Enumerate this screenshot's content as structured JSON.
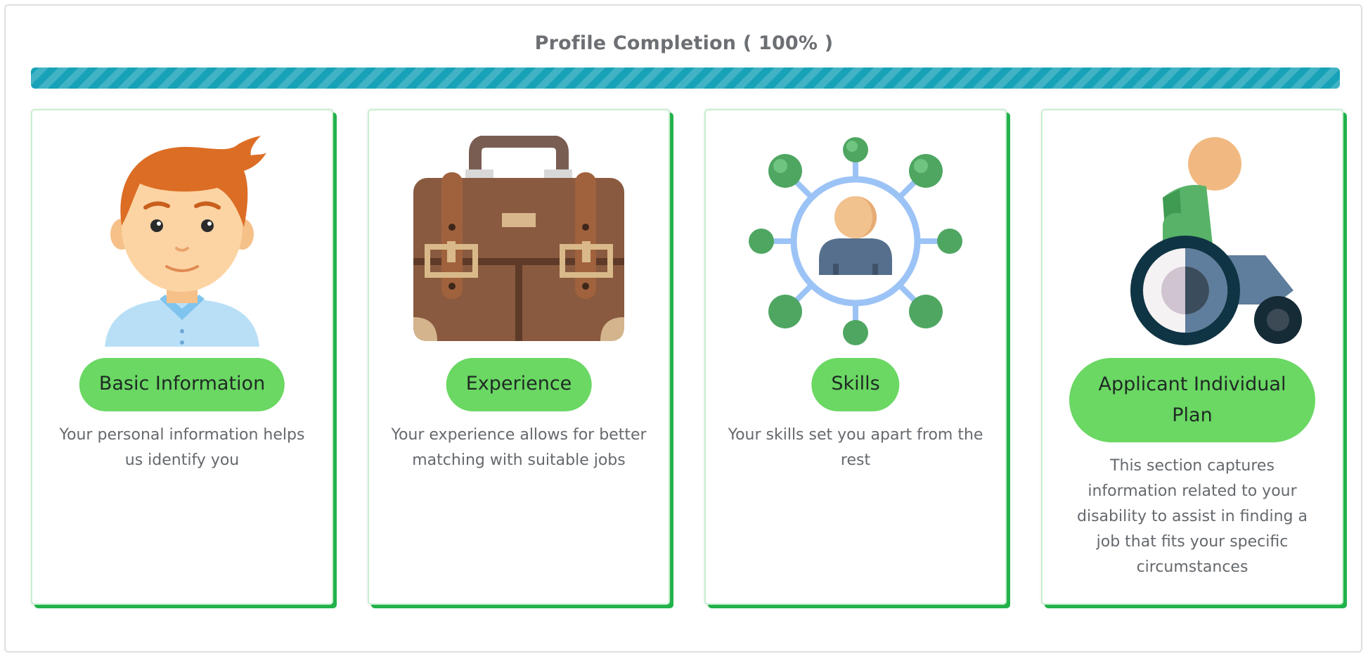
{
  "header": {
    "title": "Profile Completion ( 100% )",
    "progress_percent": 100,
    "progress_color": "#17a2b8"
  },
  "colors": {
    "pill": "#6ad863",
    "card_shadow": "#22b24c",
    "text_muted": "#65696d"
  },
  "cards": [
    {
      "icon": "person-avatar-icon",
      "button_label": "Basic Information",
      "description": "Your personal information helps us identify you"
    },
    {
      "icon": "briefcase-icon",
      "button_label": "Experience",
      "description": "Your experience allows for better matching with suitable jobs"
    },
    {
      "icon": "skills-network-icon",
      "button_label": "Skills",
      "description": "Your skills set you apart from the rest"
    },
    {
      "icon": "wheelchair-icon",
      "button_label": "Applicant Individual Plan",
      "description": "This section captures information related to your disability to assist in finding a job that fits your specific circumstances"
    }
  ]
}
